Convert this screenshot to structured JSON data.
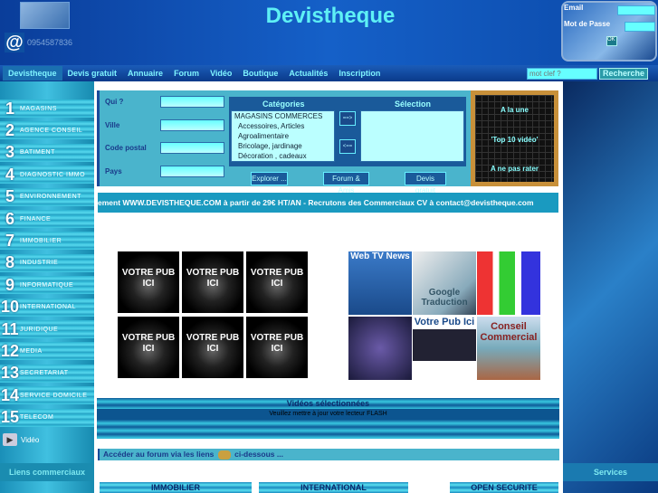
{
  "header": {
    "title": "Devistheque",
    "phone": "0954587836",
    "at_icon": "@"
  },
  "login": {
    "email_label": "Email",
    "password_label": "Mot de Passe",
    "ok_label": "OK"
  },
  "nav": {
    "items": [
      "Devistheque",
      "Devis gratuit",
      "Annuaire",
      "Forum",
      "Vidéo",
      "Boutique",
      "Actualités",
      "Inscription"
    ],
    "search_placeholder": "mot clef ?",
    "search_button": "Recherche"
  },
  "sidebar": {
    "categories": [
      {
        "n": "1",
        "label": "MAGASINS"
      },
      {
        "n": "2",
        "label": "AGENCE CONSEIL"
      },
      {
        "n": "3",
        "label": "BATIMENT"
      },
      {
        "n": "4",
        "label": "DIAGNOSTIC IMMO"
      },
      {
        "n": "5",
        "label": "ENVIRONNEMENT"
      },
      {
        "n": "6",
        "label": "FINANCE"
      },
      {
        "n": "7",
        "label": "IMMOBILIER"
      },
      {
        "n": "8",
        "label": "INDUSTRIE"
      },
      {
        "n": "9",
        "label": "INFORMATIQUE"
      },
      {
        "n": "10",
        "label": "INTERNATIONAL"
      },
      {
        "n": "11",
        "label": "JURIDIQUE"
      },
      {
        "n": "12",
        "label": "MEDIA"
      },
      {
        "n": "13",
        "label": "SECRETARIAT"
      },
      {
        "n": "14",
        "label": "SERVICE DOMICILE"
      },
      {
        "n": "15",
        "label": "TELECOM"
      }
    ],
    "video_label": "Vidéo",
    "links_label": "Liens commerciaux"
  },
  "right": {
    "services_label": "Services"
  },
  "search_panel": {
    "labels": [
      "Qui ?",
      "Ville",
      "Code postal",
      "Pays"
    ],
    "categories_title": "Catégories",
    "selection_title": "Sélection",
    "category_options": [
      "MAGASINS COMMERCES",
      "Accessoires, Articles",
      "Agroalimentaire",
      "Bricolage, jardinage",
      "Décoration , cadeaux"
    ],
    "add_button": "==>",
    "remove_button": "<==",
    "buttons": [
      "Explorer ...",
      "Forum & Amis",
      "Devis gratuit"
    ]
  },
  "board": {
    "items": [
      "A la une",
      "'Top 10 vidéo'",
      "A ne pas rater"
    ]
  },
  "ticker": "ement WWW.DEVISTHEQUE.COM à partir de 29€ HT/AN - Recrutons des Commerciaux CV à contact@devistheque.com",
  "pubs": [
    "VOTRE PUB ICI",
    "VOTRE PUB ICI",
    "VOTRE PUB ICI",
    "VOTRE PUB ICI",
    "VOTRE PUB ICI",
    "VOTRE PUB ICI"
  ],
  "promo_images": [
    "Web TV News",
    "Google Traduction",
    "",
    "",
    "Votre Pub Ici",
    "Conseil Commercial"
  ],
  "videos": {
    "title": "Vidéos sélectionnées",
    "flash_message": "Veuillez mettre à jour votre lecteur FLASH"
  },
  "forum": {
    "text_before": "Accéder au forum via les liens",
    "text_after": "ci-dessous ..."
  },
  "bottom_tabs": [
    "IMMOBILIER",
    "INTERNATIONAL",
    "OPEN SECURITE"
  ]
}
